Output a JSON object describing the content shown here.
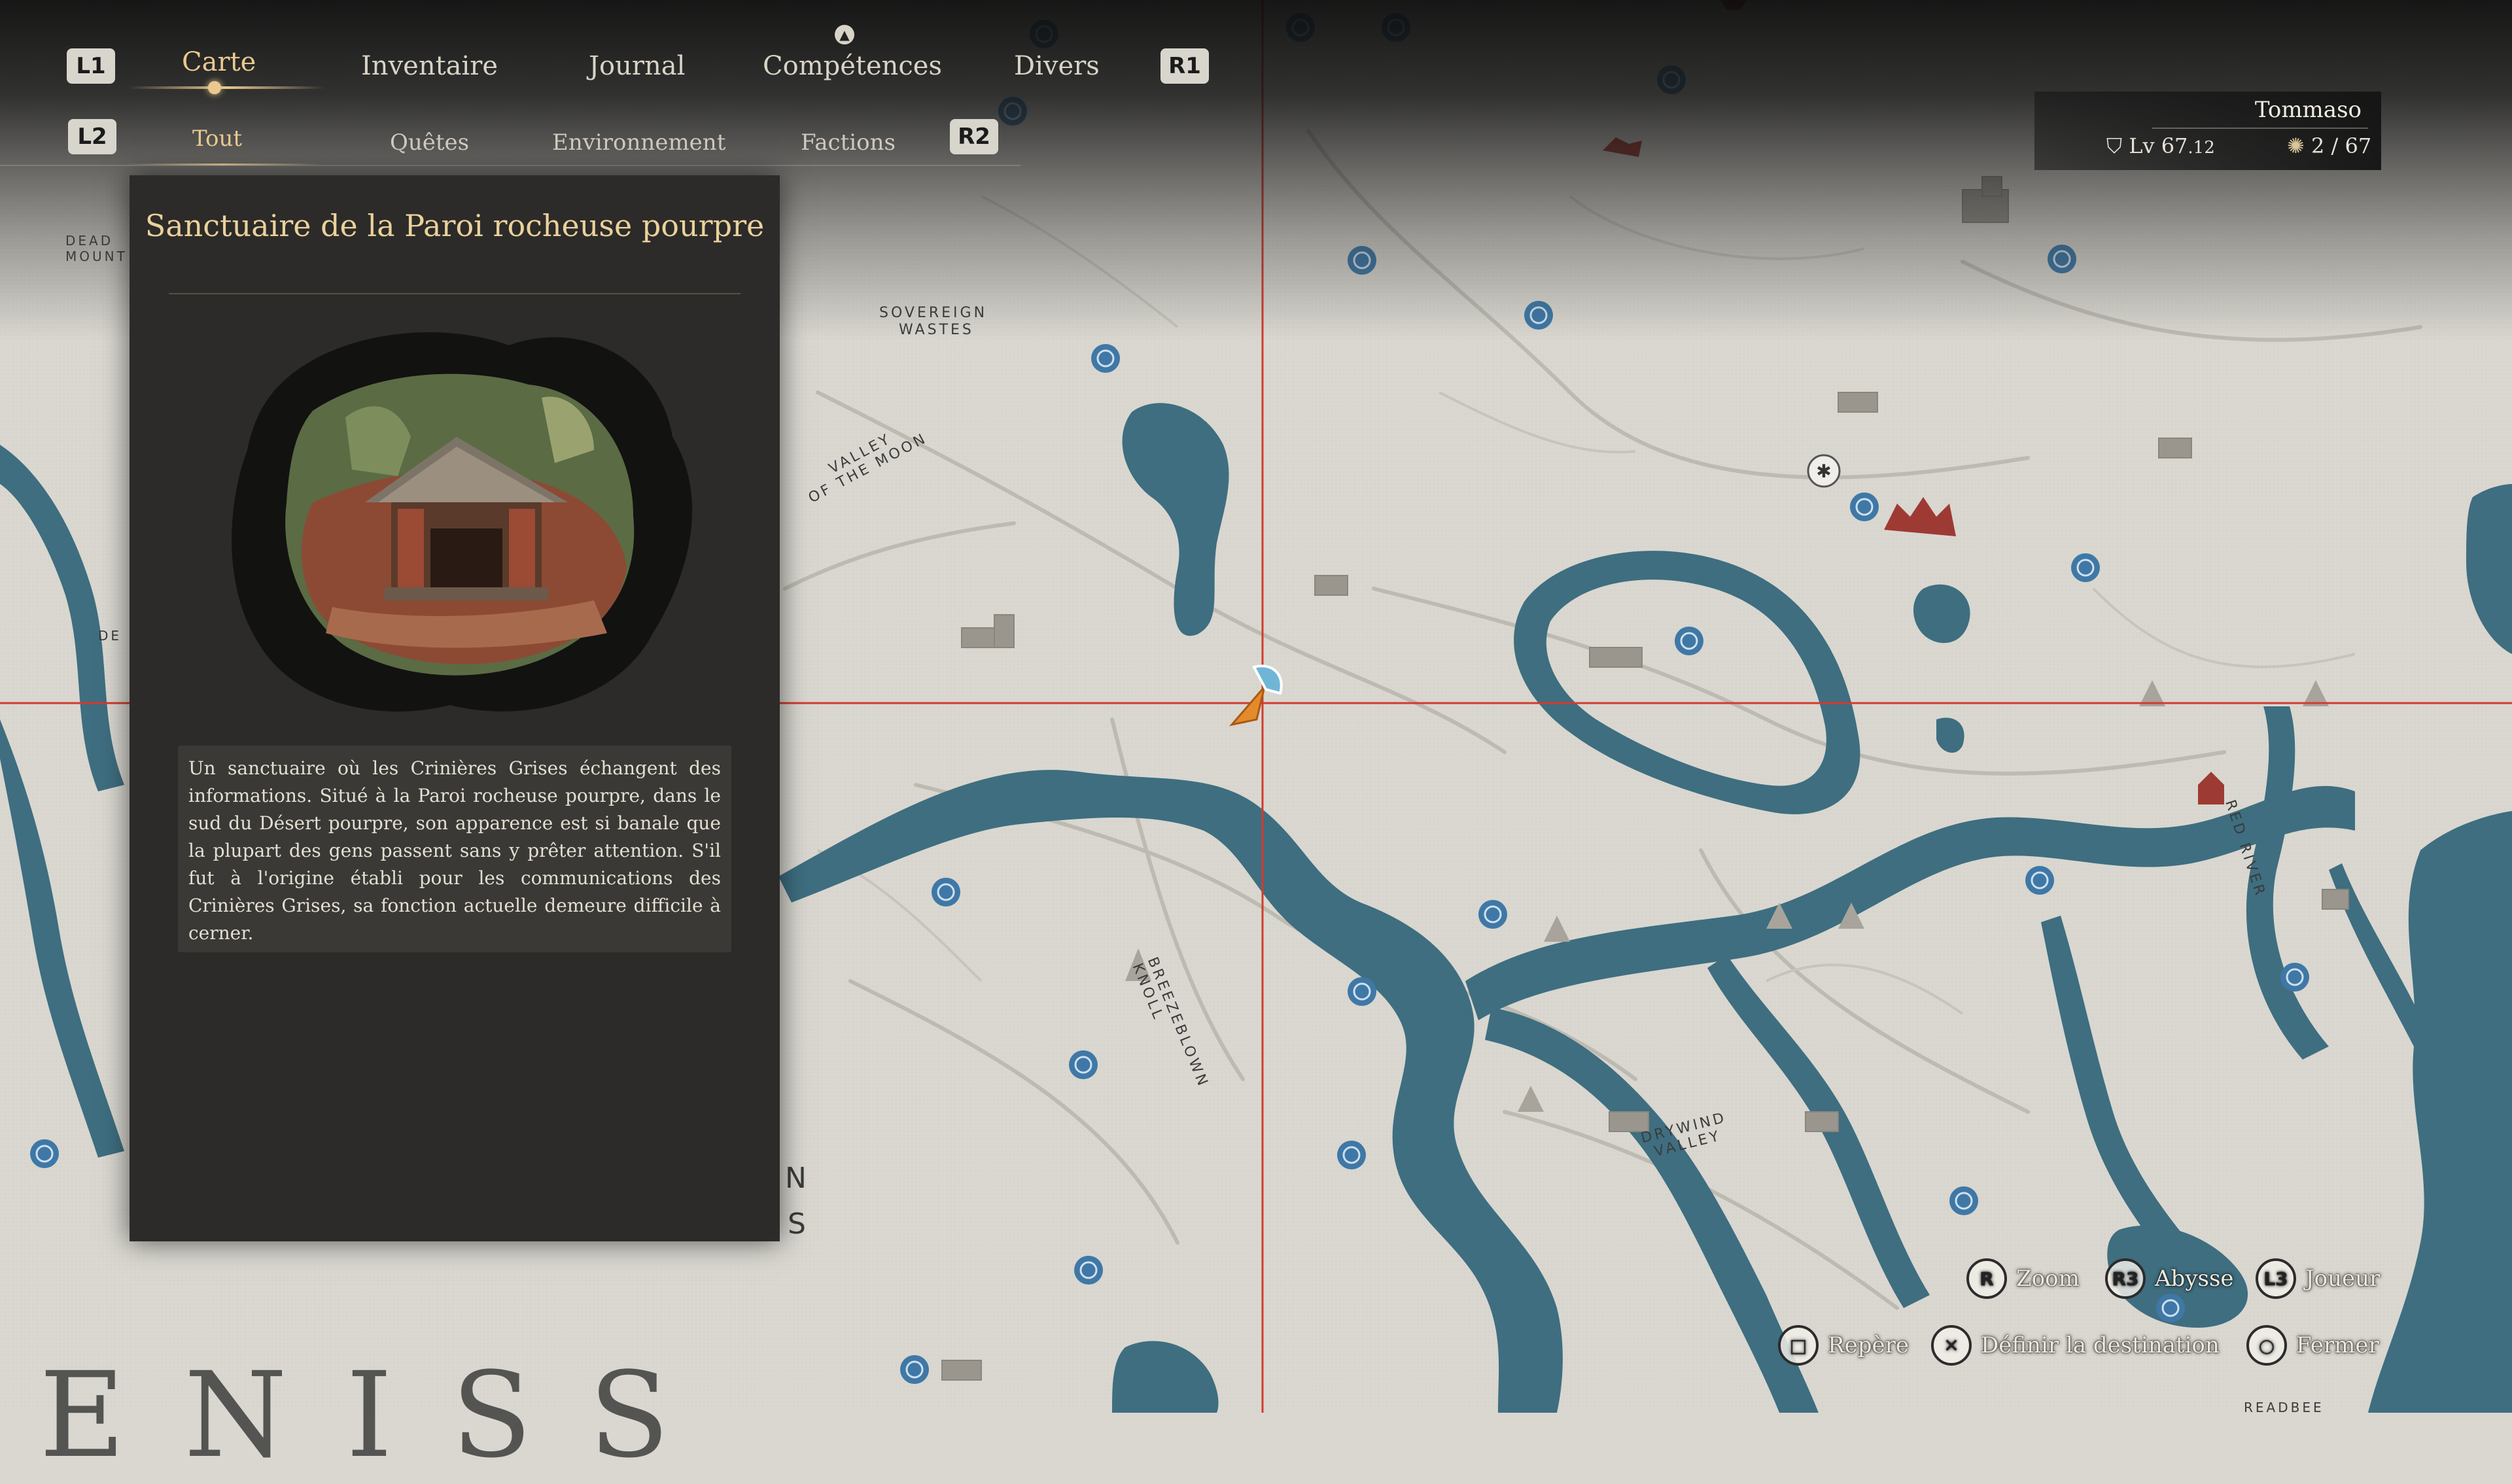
{
  "nav": {
    "l1": "L1",
    "r1": "R1",
    "l2": "L2",
    "r2": "R2",
    "tabs": [
      {
        "label": "Carte"
      },
      {
        "label": "Inventaire"
      },
      {
        "label": "Journal"
      },
      {
        "label": "Compétences"
      },
      {
        "label": "Divers"
      }
    ],
    "subtabs": [
      {
        "label": "Tout"
      },
      {
        "label": "Quêtes"
      },
      {
        "label": "Environnement"
      },
      {
        "label": "Factions"
      }
    ],
    "active_tab": "Carte",
    "active_subtab": "Tout"
  },
  "location_panel": {
    "title": "Sanctuaire de la Paroi rocheuse pourpre",
    "description": "Un sanctuaire où les Crinières Grises échangent des informations. Situé à la Paroi rocheuse pourpre, dans le sud du Désert pourpre, son apparence est si banale que la plupart des gens passent sans y prêter attention. S'il fut à l'origine établi pour les communications des Crinières Grises, sa fonction actuelle demeure difficile à cerner."
  },
  "player": {
    "name": "Tommaso",
    "level_label": "Lv",
    "level": "67",
    "level_fraction": ".12",
    "collect_current": "2",
    "collect_sep": "/",
    "collect_total": "67"
  },
  "map_labels": {
    "dead_mount": "DEAD\nMOUNT",
    "sovereign": "SOVEREIGN",
    "wastes": "WASTES",
    "valley_moon": "VALLEY\nOF THE MOON",
    "breezeblown": "BREEZEBLOWN\nKNOLL",
    "drywind": "DRYWIND\nVALLEY",
    "red_river": "RED RIVER",
    "de": "DE",
    "n": "N",
    "s": "S",
    "region": "ENISS",
    "readbee": "READBEE"
  },
  "controls": {
    "zoom": {
      "button": "R",
      "label": "Zoom"
    },
    "abyss": {
      "button": "R3",
      "label": "Abysse"
    },
    "player": {
      "button": "L3",
      "label": "Joueur"
    },
    "marker": {
      "button": "□",
      "label": "Repère"
    },
    "destination": {
      "button": "✕",
      "label": "Définir la destination"
    },
    "close": {
      "button": "○",
      "label": "Fermer"
    }
  },
  "colors": {
    "water": "#3e6e80",
    "land": "#d9d7d0",
    "crosshair": "#d23b2f",
    "accent": "#e9c98f",
    "waypoint": "#3f78a6"
  },
  "icons": {
    "waypoint": "waypoint-icon",
    "player_marker": "player-arrow-icon",
    "level": "level-crest-icon",
    "collectible": "sun-icon"
  }
}
